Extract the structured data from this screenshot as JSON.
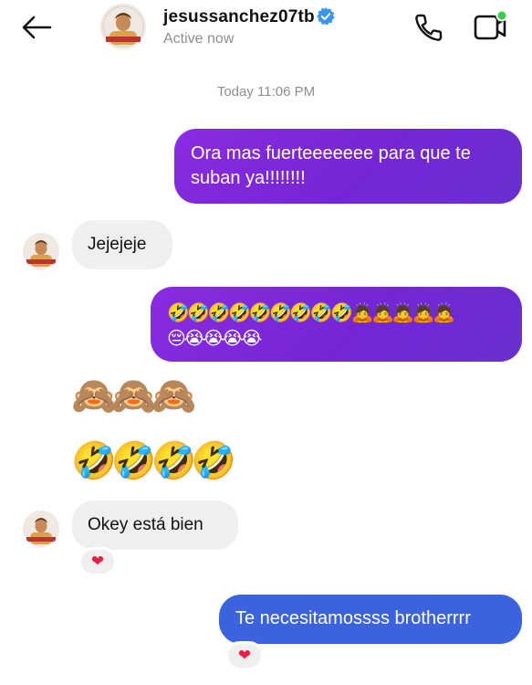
{
  "header": {
    "username": "jesussanchez07tb",
    "status": "Active now",
    "icons": {
      "back": "back-arrow-icon",
      "verified": "verified-badge-icon",
      "call": "phone-icon",
      "video": "video-camera-icon"
    },
    "colors": {
      "verified": "#3897f0",
      "online_dot": "#3ccb4f"
    }
  },
  "timestamp": "Today 11:06 PM",
  "messages": [
    {
      "id": "m1",
      "from": "me",
      "text": "Ora mas fuerteeeeeee para que te suban ya!!!!!!!!"
    },
    {
      "id": "m2",
      "from": "them",
      "text": "Jejejeje"
    },
    {
      "id": "m3",
      "from": "me",
      "line1": "🤣🤣🤣🤣🤣🤣🤣🤣🤣🙇🙇🙇🙇🙇",
      "line2": "😔😭😭😭😭"
    },
    {
      "id": "m4",
      "from": "them",
      "text": "🙈🙈🙈"
    },
    {
      "id": "m5",
      "from": "them",
      "text": "🤣🤣🤣🤣"
    },
    {
      "id": "m6",
      "from": "them",
      "text": "Okey está bien",
      "reaction": "❤"
    },
    {
      "id": "m7",
      "from": "me",
      "text": "Te necesitamossss brotherrrr",
      "reaction": "❤"
    }
  ],
  "colors": {
    "outgoing_gradient": [
      "#8a2be2",
      "#6a2fd0"
    ],
    "outgoing_blue": "#3b63e0",
    "incoming": "#efefef",
    "heart": "#ed1c44"
  }
}
